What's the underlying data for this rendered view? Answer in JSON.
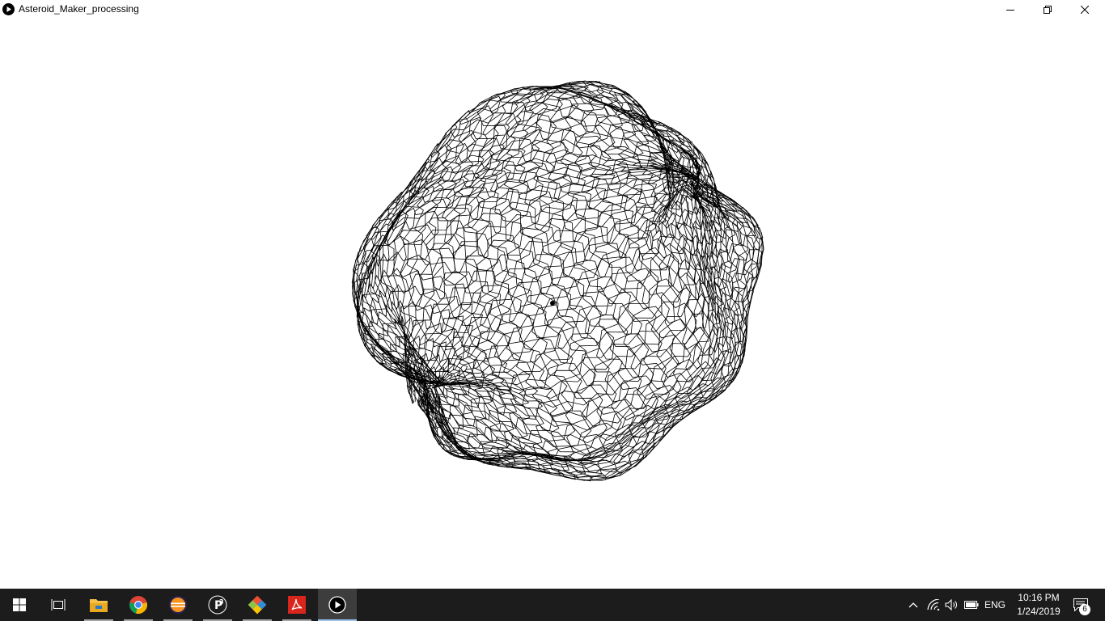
{
  "window": {
    "title": "Asteroid_Maker_processing",
    "app_icon": "processing-play-icon",
    "controls": [
      "minimize-icon",
      "restore-icon",
      "close-icon"
    ]
  },
  "canvas": {
    "background": "#ffffff",
    "content": "wireframe-asteroid",
    "stroke_color": "#000000"
  },
  "taskbar": {
    "background": "#1c1c1c",
    "pinned": [
      {
        "name": "start",
        "icon": "windows-start-icon"
      },
      {
        "name": "task-view",
        "icon": "task-view-icon"
      },
      {
        "name": "file-explorer",
        "icon": "folder-icon"
      },
      {
        "name": "chrome",
        "icon": "chrome-icon"
      },
      {
        "name": "eclipse",
        "icon": "eclipse-icon"
      },
      {
        "name": "processing3",
        "icon": "processing3-icon"
      },
      {
        "name": "git",
        "icon": "git-icon"
      },
      {
        "name": "acrobat",
        "icon": "acrobat-icon"
      },
      {
        "name": "running-sketch",
        "icon": "processing-play-icon",
        "active": true
      }
    ],
    "tray": {
      "language": "ENG",
      "time": "10:16 PM",
      "date": "1/24/2019",
      "notification_count": "6"
    }
  }
}
